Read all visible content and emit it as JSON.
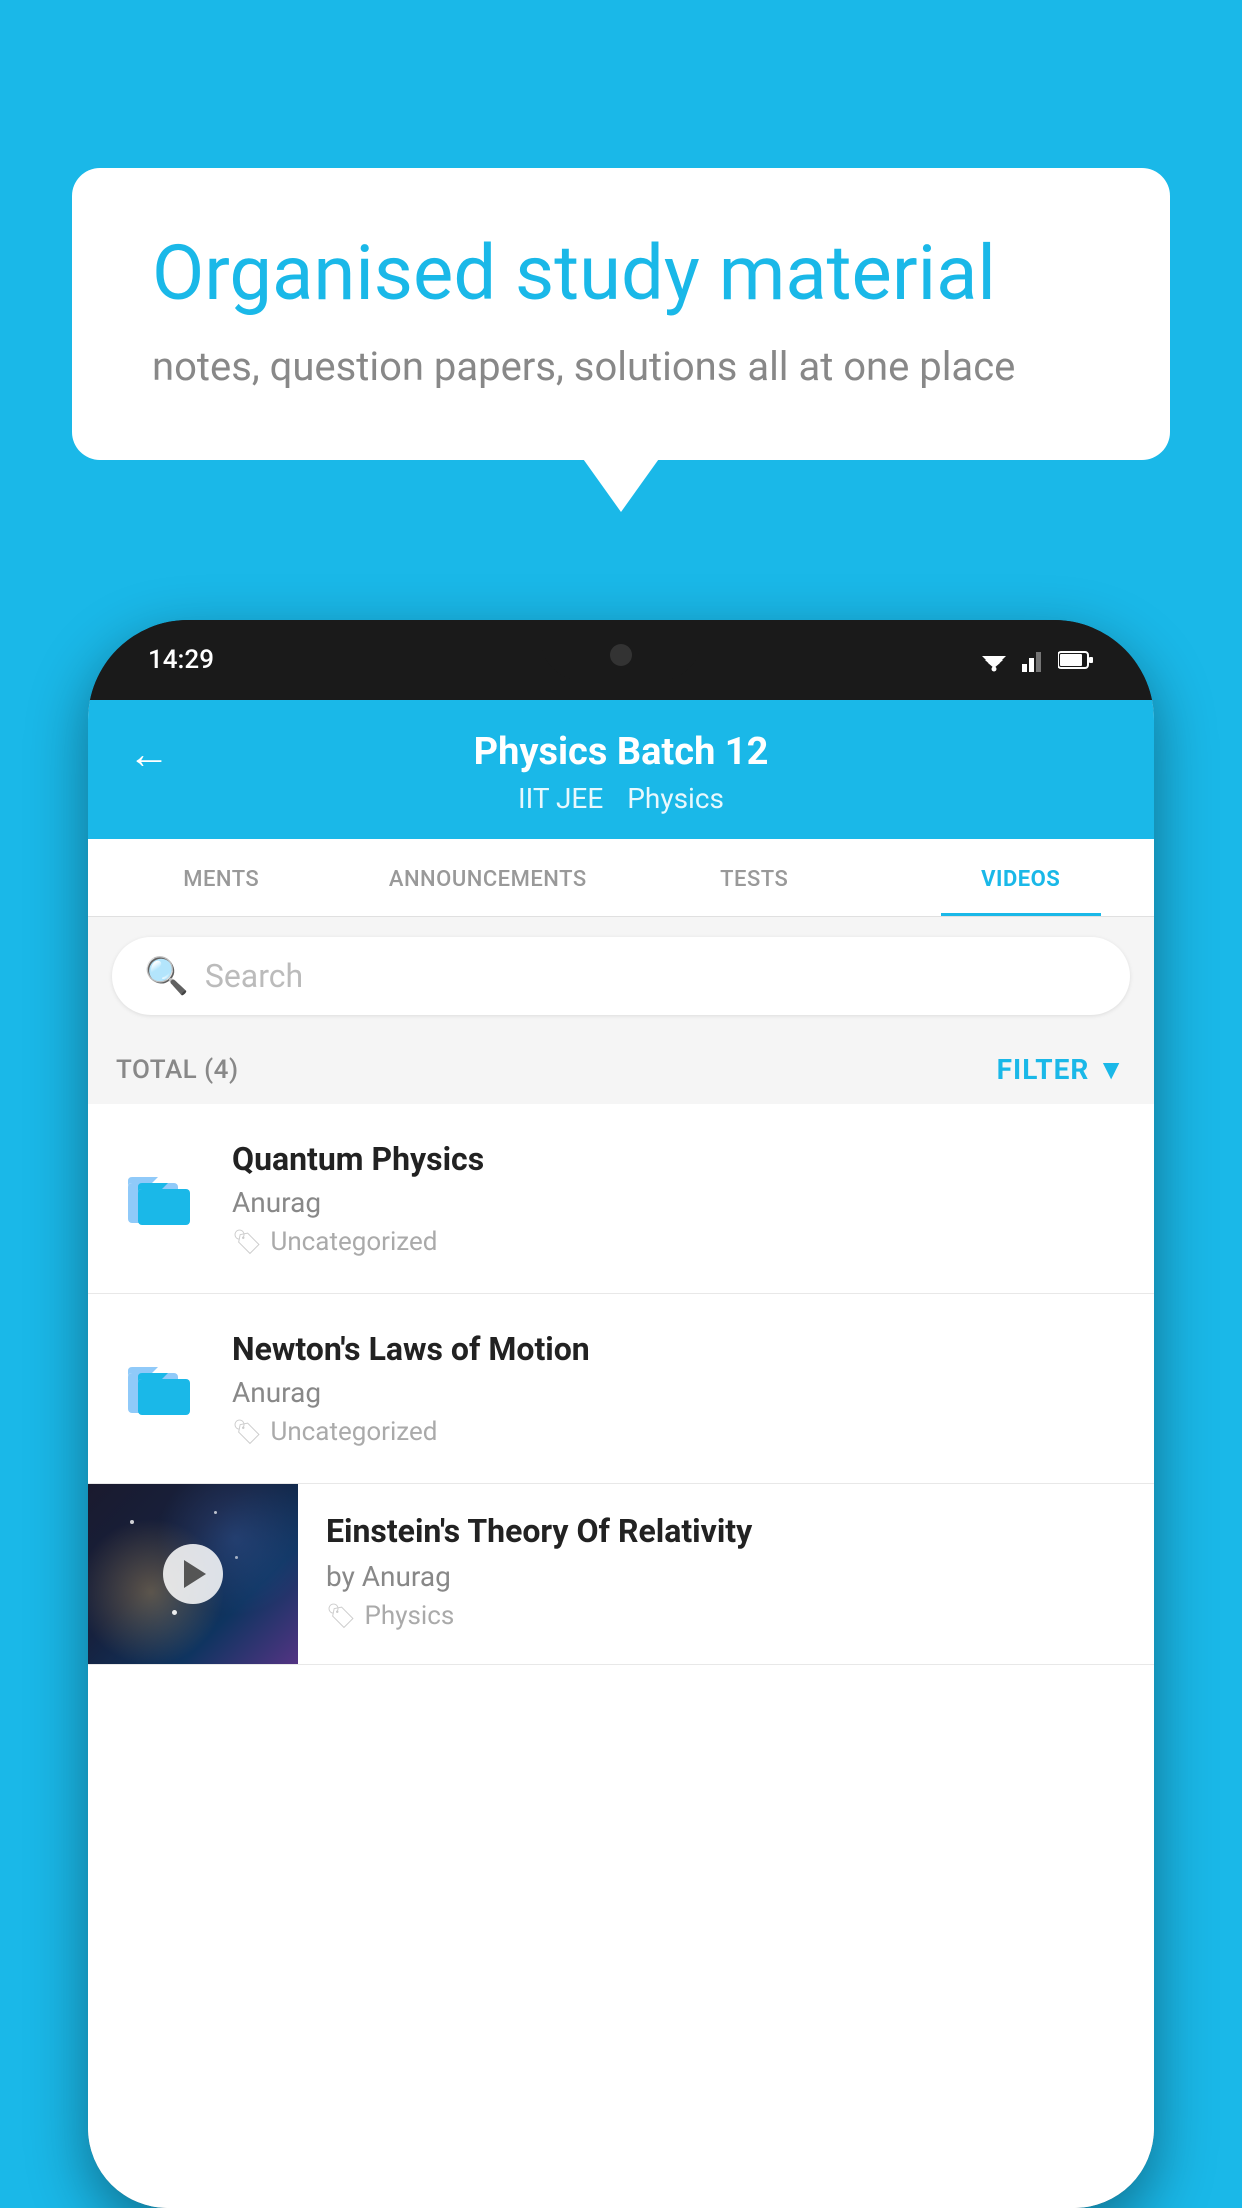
{
  "background": {
    "color": "#1ab8e8"
  },
  "speech_bubble": {
    "title": "Organised study material",
    "subtitle": "notes, question papers, solutions all at one place"
  },
  "phone": {
    "status_bar": {
      "time": "14:29"
    },
    "header": {
      "back_label": "←",
      "title": "Physics Batch 12",
      "subtitle1": "IIT JEE",
      "subtitle2": "Physics"
    },
    "tabs": [
      {
        "label": "MENTS",
        "active": false
      },
      {
        "label": "ANNOUNCEMENTS",
        "active": false
      },
      {
        "label": "TESTS",
        "active": false
      },
      {
        "label": "VIDEOS",
        "active": true
      }
    ],
    "search": {
      "placeholder": "Search"
    },
    "filter_bar": {
      "total": "TOTAL (4)",
      "filter_label": "FILTER"
    },
    "items": [
      {
        "type": "folder",
        "title": "Quantum Physics",
        "author": "Anurag",
        "tag": "Uncategorized"
      },
      {
        "type": "folder",
        "title": "Newton's Laws of Motion",
        "author": "Anurag",
        "tag": "Uncategorized"
      },
      {
        "type": "video",
        "title": "Einstein's Theory Of Relativity",
        "author": "by Anurag",
        "tag": "Physics"
      }
    ]
  }
}
